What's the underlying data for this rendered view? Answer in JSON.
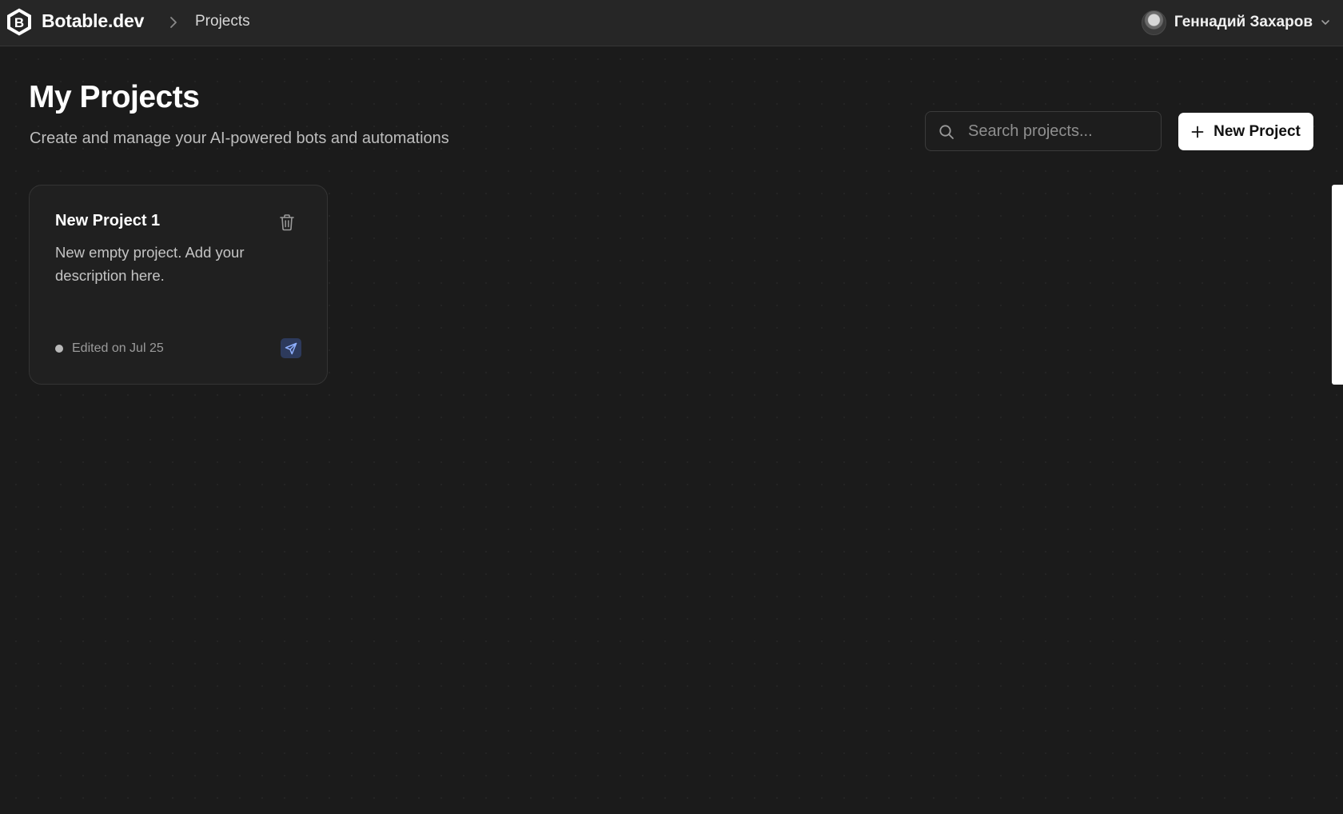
{
  "topbar": {
    "brand": "Botable.dev",
    "logo_icon": "hexagon-b-logo",
    "breadcrumb_current": "Projects",
    "user_name": "Геннадий Захаров"
  },
  "header": {
    "title": "My Projects",
    "subtitle": "Create and manage your AI-powered bots and automations"
  },
  "search": {
    "placeholder": "Search projects...",
    "value": ""
  },
  "actions": {
    "new_project_label": "New Project"
  },
  "projects": [
    {
      "title": "New Project 1",
      "description": "New empty project. Add your description here.",
      "edited": "Edited on Jul 25"
    }
  ],
  "colors": {
    "background": "#1b1b1b",
    "topbar": "#262626",
    "card": "#202020",
    "accent_send": "#2d3a5c",
    "send_icon": "#8fb0ff"
  }
}
